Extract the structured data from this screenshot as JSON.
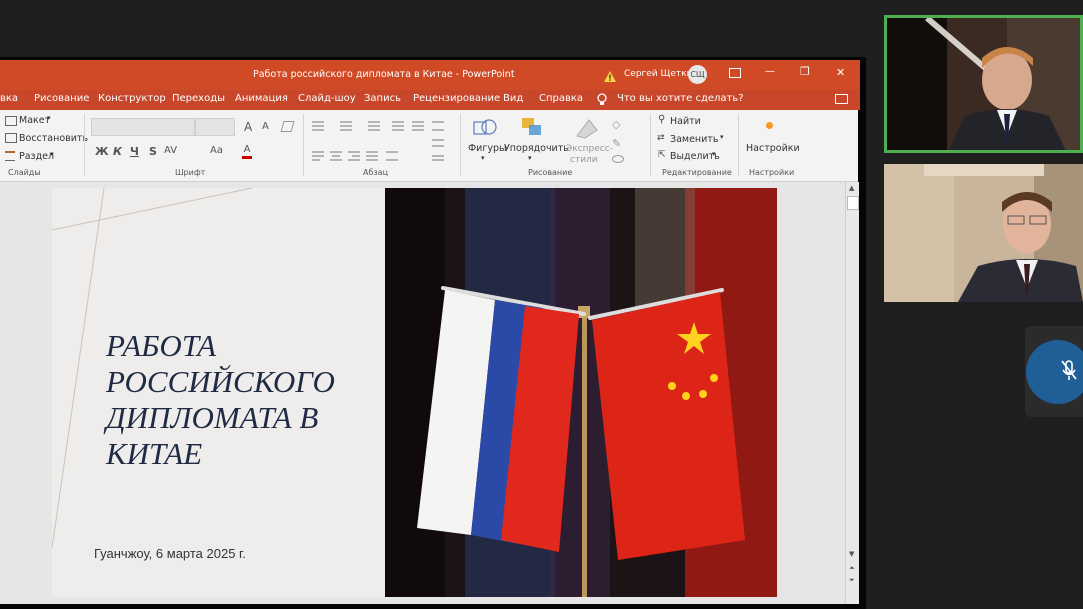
{
  "titlebar": {
    "doc_title": "Работа российского дипломата в Китае  -  PowerPoint",
    "user_name": "Сергей Щеткин",
    "user_initials": "СЩ",
    "min_glyph": "—",
    "restore_glyph": "❐",
    "close_glyph": "✕"
  },
  "tabs": [
    "вка",
    "Рисование",
    "Конструктор",
    "Переходы",
    "Анимация",
    "Слайд-шоу",
    "Запись",
    "Рецензирование",
    "Вид",
    "Справка"
  ],
  "tell_me": "Что вы хотите сделать?",
  "ribbon": {
    "slides": {
      "layout": "Макет",
      "reset": "Восстановить",
      "section": "Раздел",
      "label": "Слайды"
    },
    "font": {
      "label": "Шрифт",
      "bold": "Ж",
      "italic": "К",
      "underline": "Ч",
      "strike": "S",
      "spacing": "AV",
      "case": "Aa",
      "grow": "A",
      "shrink": "A"
    },
    "paragraph": {
      "label": "Абзац"
    },
    "drawing": {
      "shapes": "Фигуры",
      "arrange": "Упорядочить",
      "styles_1": "Экспресс-",
      "styles_2": "стили",
      "label": "Рисование"
    },
    "editing": {
      "find": "Найти",
      "replace": "Заменить",
      "select": "Выделить",
      "label": "Редактирование"
    },
    "addins": {
      "button": "Настройки",
      "label": "Настройки"
    }
  },
  "slide": {
    "title": "РАБОТА\nРОССИЙСКОГО\nДИПЛОМАТА В\nКИТАЕ",
    "subtitle": "Гуанчжоу, 6 марта 2025 г."
  },
  "colors": {
    "titlebar": "#d04b25",
    "tabs": "#c8462a",
    "active_speaker_border": "#4caf50",
    "mute_circle": "#1f5e96",
    "slide_title": "#1f2a44"
  }
}
